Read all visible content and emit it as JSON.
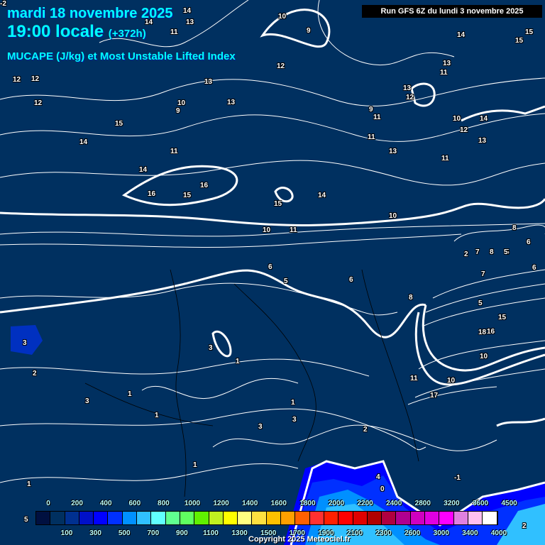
{
  "header": {
    "date": "mardi 18 novembre 2025",
    "time": "19:00 locale",
    "lead": "(+372h)",
    "parameter": "MUCAPE (J/kg) et Most Unstable Lifted Index",
    "run": "Run GFS 6Z du lundi 3 novembre 2025"
  },
  "contour_labels": [
    "10",
    "9",
    "14",
    "13",
    "11",
    "14",
    "15",
    "15",
    "14",
    "13",
    "12",
    "11",
    "12",
    "12",
    "13",
    "12",
    "13",
    "12",
    "10",
    "9",
    "13",
    "13",
    "9",
    "11",
    "10",
    "12",
    "14",
    "15",
    "14",
    "11",
    "11",
    "13",
    "14",
    "11",
    "16",
    "15",
    "16",
    "15",
    "14",
    "10",
    "10",
    "11",
    "8",
    "6",
    "6",
    "5",
    "6",
    "5",
    "3",
    "2",
    "1",
    "3",
    "1",
    "1",
    "3",
    "3",
    "2",
    "1",
    "1",
    "1",
    "4",
    "0",
    "-1",
    "3",
    "5",
    "15",
    "18",
    "16",
    "17",
    "10",
    "11",
    "10",
    "2",
    "7",
    "8",
    "7",
    "6",
    "5",
    "8",
    "5",
    "2",
    "-2"
  ],
  "legend": {
    "top_labels": [
      "0",
      "200",
      "400",
      "600",
      "800",
      "1000",
      "1200",
      "1400",
      "1600",
      "1800",
      "2000",
      "2200",
      "2400",
      "2800",
      "3200",
      "3600",
      "4500"
    ],
    "bottom_labels": [
      "100",
      "300",
      "500",
      "700",
      "900",
      "1100",
      "1300",
      "1500",
      "1700",
      "1900",
      "2100",
      "2300",
      "2600",
      "3000",
      "3400",
      "4000"
    ],
    "colors": [
      "#001040",
      "#003060",
      "#003090",
      "#0010c8",
      "#0000ff",
      "#0030ff",
      "#0090ff",
      "#30c0ff",
      "#60ffff",
      "#60ff90",
      "#60ff60",
      "#60f000",
      "#c0f020",
      "#ffff00",
      "#ffff80",
      "#ffe040",
      "#ffc000",
      "#ffa000",
      "#ff6000",
      "#ff3030",
      "#ff2000",
      "#ff0000",
      "#e00000",
      "#b00000",
      "#b00040",
      "#b00090",
      "#d000c0",
      "#e000e0",
      "#ff00ff",
      "#e080e0",
      "#ffc0f0",
      "#ffffff"
    ]
  },
  "copyright": "Copyright 2025 Meteociel.fr"
}
